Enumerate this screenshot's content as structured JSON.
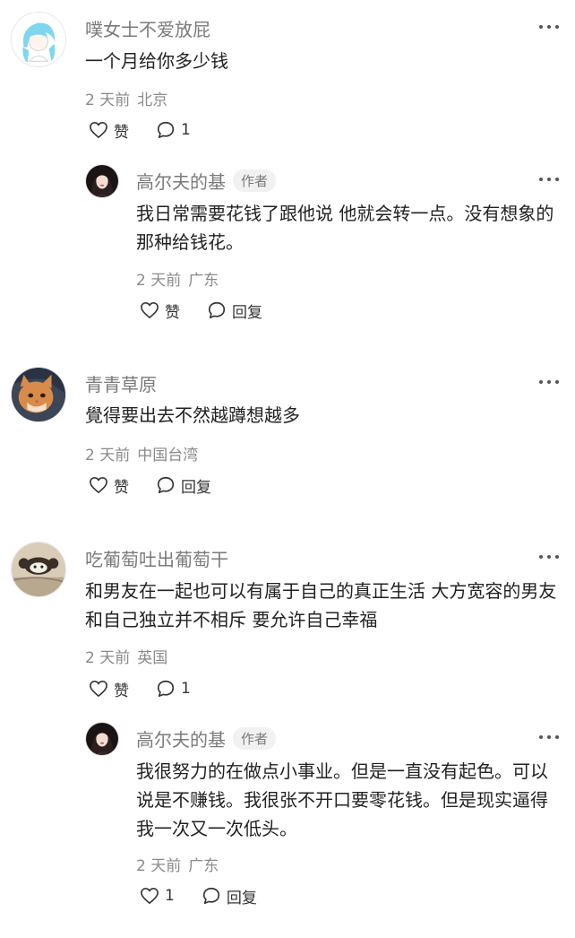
{
  "labels": {
    "like": "赞",
    "reply": "回复",
    "author_badge": "作者"
  },
  "comments": [
    {
      "name": "噗女士不爱放屁",
      "text": "一个月给你多少钱",
      "time": "2 天前",
      "location": "北京",
      "reply_count": "1",
      "replies": [
        {
          "name": "高尔夫的基",
          "text": "我日常需要花钱了跟他说 他就会转一点。没有想象的那种给钱花。",
          "time": "2 天前",
          "location": "广东"
        }
      ]
    },
    {
      "name": "青青草原",
      "text": "覺得要出去不然越蹲想越多",
      "time": "2 天前",
      "location": "中国台湾"
    },
    {
      "name": "吃葡萄吐出葡萄干",
      "text": "和男友在一起也可以有属于自己的真正生活 大方宽容的男友和自己独立并不相斥 要允许自己幸福",
      "time": "2 天前",
      "location": "英国",
      "reply_count": "1",
      "replies": [
        {
          "name": "高尔夫的基",
          "text": "我很努力的在做点小事业。但是一直没有起色。可以说是不赚钱。我很张不开口要零花钱。但是现实逼得我一次又一次低头。",
          "time": "2 天前",
          "location": "广东",
          "like_count": "1"
        }
      ]
    }
  ]
}
